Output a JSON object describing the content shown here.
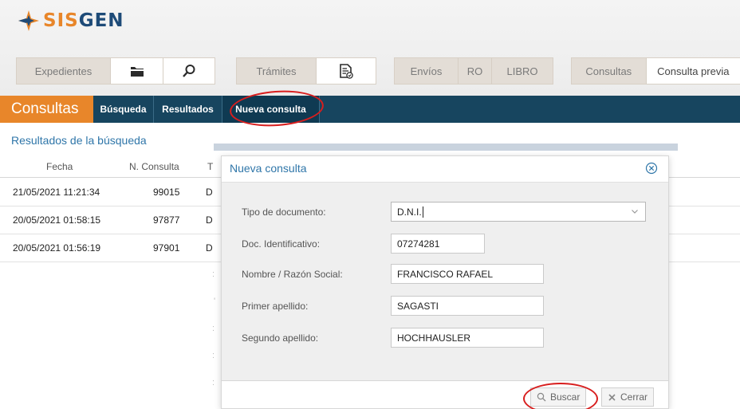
{
  "app": {
    "logo_text_a": "SIS",
    "logo_text_b": "GEN"
  },
  "nav": {
    "expedientes": "Expedientes",
    "tramites": "Trámites",
    "envios": "Envíos",
    "ro": "RO",
    "libro": "LIBRO",
    "consultas": "Consultas",
    "consulta_previa": "Consulta previa"
  },
  "subnav": {
    "title": "Consultas",
    "busqueda": "Búsqueda",
    "resultados": "Resultados",
    "nueva_consulta": "Nueva consulta"
  },
  "results": {
    "title": "Resultados de la búsqueda",
    "columns": [
      "Fecha",
      "N. Consulta",
      "T"
    ],
    "rows": [
      {
        "fecha": "21/05/2021 11:21:34",
        "num": "99015",
        "tipo": "D"
      },
      {
        "fecha": "20/05/2021 01:58:15",
        "num": "97877",
        "tipo": "D"
      },
      {
        "fecha": "20/05/2021 01:56:19",
        "num": "97901",
        "tipo": "D"
      }
    ]
  },
  "modal": {
    "title": "Nueva consulta",
    "fields": {
      "tipo_documento": {
        "label": "Tipo de documento:",
        "value": "D.N.I."
      },
      "doc_identificativo": {
        "label": "Doc. Identificativo:",
        "value": "07274281"
      },
      "nombre": {
        "label": "Nombre / Razón Social:",
        "value": "FRANCISCO RAFAEL"
      },
      "primer_apellido": {
        "label": "Primer apellido:",
        "value": "SAGASTI"
      },
      "segundo_apellido": {
        "label": "Segundo apellido:",
        "value": "HOCHHAUSLER"
      }
    },
    "buttons": {
      "buscar": "Buscar",
      "cerrar": "Cerrar"
    }
  },
  "colors": {
    "brand_orange": "#e8862a",
    "brand_blue": "#1e4b78",
    "bar_blue": "#17455f",
    "link_blue": "#2f76a9",
    "annotation_red": "#d81e1e"
  }
}
